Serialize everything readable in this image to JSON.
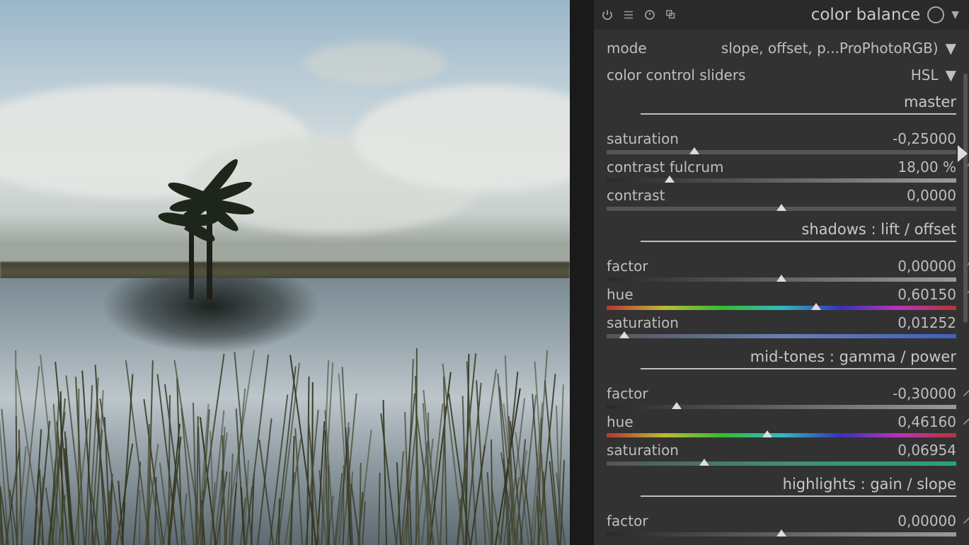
{
  "module": {
    "title": "color balance",
    "mode_label": "mode",
    "mode_value": "slope, offset, p...ProPhotoRGB)",
    "sliders_label": "color control sliders",
    "sliders_value": "HSL"
  },
  "sections": {
    "master": {
      "title": "master",
      "saturation": {
        "label": "saturation",
        "value": "-0,25000",
        "pos": 25
      },
      "contrast_fulcrum": {
        "label": "contrast fulcrum",
        "value": "18,00 %",
        "pos": 18
      },
      "contrast": {
        "label": "contrast",
        "value": "0,0000",
        "pos": 50
      }
    },
    "shadows": {
      "title": "shadows : lift / offset",
      "factor": {
        "label": "factor",
        "value": "0,00000",
        "pos": 50
      },
      "hue": {
        "label": "hue",
        "value": "0,60150",
        "pos": 60
      },
      "saturation": {
        "label": "saturation",
        "value": "0,01252",
        "pos": 5
      }
    },
    "midtones": {
      "title": "mid-tones : gamma / power",
      "factor": {
        "label": "factor",
        "value": "-0,30000",
        "pos": 20
      },
      "hue": {
        "label": "hue",
        "value": "0,46160",
        "pos": 46
      },
      "saturation": {
        "label": "saturation",
        "value": "0,06954",
        "pos": 28
      }
    },
    "highlights": {
      "title": "highlights : gain / slope",
      "factor": {
        "label": "factor",
        "value": "0,00000",
        "pos": 50
      }
    }
  }
}
